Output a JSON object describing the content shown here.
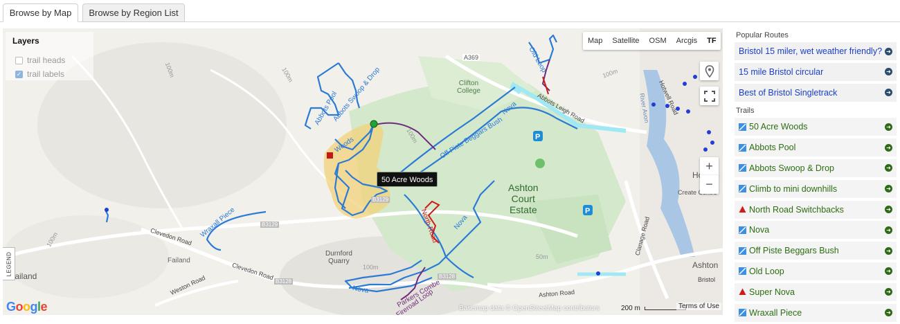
{
  "tabs": [
    {
      "label": "Browse by Map",
      "active": true
    },
    {
      "label": "Browse by Region List",
      "active": false
    }
  ],
  "map": {
    "layers": {
      "title": "Layers",
      "items": [
        {
          "label": "trail heads",
          "checked": false
        },
        {
          "label": "trail labels",
          "checked": true
        }
      ]
    },
    "map_types": [
      "Map",
      "Satellite",
      "OSM",
      "Arcgis",
      "TF"
    ],
    "active_map_type": "TF",
    "legend_label": "LEGEND",
    "tooltip": "50 Acre Woods",
    "google_logo": "Google",
    "attribution": "Basemap data © OpenStreetMap contributors",
    "scale": "200 m",
    "terms": "Terms of Use",
    "labels": {
      "a369": "A369",
      "b3129_a": "B3129",
      "b3129_b": "B3129",
      "b3128_a": "B3128",
      "b3128_b": "B3128",
      "clifton_college": "Clifton\nCollege",
      "ashton_court": "Ashton\nCourt\nEstate",
      "durnford": "Durnford\nQuarry",
      "failand_small": "Failand",
      "failand": "Failand",
      "clevedon1": "Clevedon Road",
      "clevedon2": "Clevedon Road",
      "weston": "Weston Road",
      "ashton_road": "Ashton Road",
      "clanage": "Clanage Road",
      "hotwell_road": "Hotwell Road",
      "river_avon": "River Avon",
      "abbots_leigh_road": "Abbots Leigh Road",
      "ashton": "Ashton",
      "bristol": "Bristol",
      "hotwells": "Hotwel",
      "create_centre": "Create Centre",
      "m100a": "100m",
      "m100b": "100m",
      "m100c": "100m",
      "m100d": "100m",
      "m50": "50m",
      "m100e": "100m",
      "m100f": "100m",
      "trail_old_loop": "Old Loop",
      "trail_abbots_swoop": "Abbots Swoop & Drop",
      "trail_abbots_pool": "Abbots Pool",
      "trail_woods": "Woods",
      "trail_off_piste": "Off Piste Beggars Bush",
      "trail_nova_top": "Nova",
      "trail_nova_mid": "Nova",
      "trail_nova_bottom": "Nova",
      "trail_north_road": "North Road",
      "trail_wraxall": "Wraxall Piece",
      "trail_parkers": "Parkers Combe",
      "trail_fireroad": "Fireroad Loop"
    },
    "colors": {
      "trail_blue": "#2a7ad6",
      "trail_purple": "#6f2c7c",
      "trail_red": "#cc1b1b",
      "highlight": "#f0cf6e",
      "park": "#cfe6c8",
      "water": "#a8dff0"
    }
  },
  "sidebar": {
    "popular_heading": "Popular Routes",
    "routes": [
      {
        "label": "Bristol 15 miler, wet weather friendly?"
      },
      {
        "label": "15 mile Bristol circular"
      },
      {
        "label": "Best of Bristol Singletrack"
      }
    ],
    "trails_heading": "Trails",
    "trails": [
      {
        "label": "50 Acre Woods",
        "icon": "blue-trail-icon"
      },
      {
        "label": "Abbots Pool",
        "icon": "blue-trail-icon"
      },
      {
        "label": "Abbots Swoop & Drop",
        "icon": "blue-trail-icon"
      },
      {
        "label": "Climb to mini downhills",
        "icon": "blue-trail-icon"
      },
      {
        "label": "North Road Switchbacks",
        "icon": "red-triangle-icon"
      },
      {
        "label": "Nova",
        "icon": "blue-trail-icon"
      },
      {
        "label": "Off Piste Beggars Bush",
        "icon": "blue-trail-icon"
      },
      {
        "label": "Old Loop",
        "icon": "blue-trail-icon"
      },
      {
        "label": "Super Nova",
        "icon": "red-triangle-icon"
      },
      {
        "label": "Wraxall Piece",
        "icon": "blue-trail-icon"
      }
    ]
  }
}
